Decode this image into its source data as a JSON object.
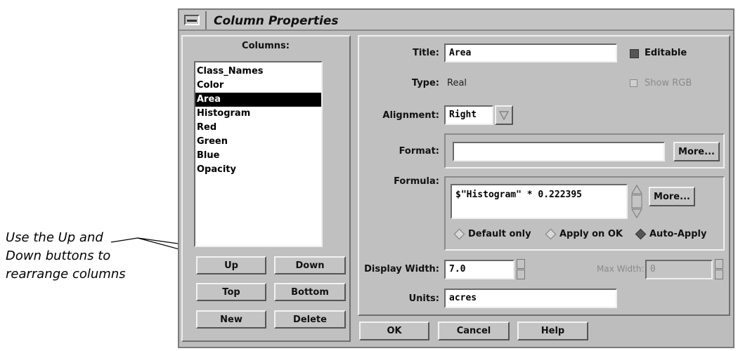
{
  "annotation": {
    "line1": "Use the Up and",
    "line2": "Down buttons to",
    "line3": "rearrange columns"
  },
  "window": {
    "title": "Column Properties"
  },
  "columns": {
    "heading": "Columns:",
    "items": [
      "Class_Names",
      "Color",
      "Area",
      "Histogram",
      "Red",
      "Green",
      "Blue",
      "Opacity"
    ],
    "selected": "Area",
    "buttons": {
      "up": "Up",
      "down": "Down",
      "top": "Top",
      "bottom": "Bottom",
      "new": "New",
      "delete": "Delete"
    }
  },
  "props": {
    "title_label": "Title:",
    "title_value": "Area",
    "editable_label": "Editable",
    "type_label": "Type:",
    "type_value": "Real",
    "show_rgb_label": "Show RGB",
    "alignment_label": "Alignment:",
    "alignment_value": "Right",
    "format_label": "Format:",
    "format_value": "",
    "format_more": "More...",
    "formula_label": "Formula:",
    "formula_value": "$\"Histogram\" * 0.222395",
    "formula_more": "More...",
    "apply_modes": [
      "Default only",
      "Apply on OK",
      "Auto-Apply"
    ],
    "apply_selected": "Auto-Apply",
    "display_width_label": "Display Width:",
    "display_width_value": "7.0",
    "max_width_label": "Max Width:",
    "max_width_value": "0",
    "units_label": "Units:",
    "units_value": "acres"
  },
  "footer": {
    "ok": "OK",
    "cancel": "Cancel",
    "help": "Help"
  }
}
